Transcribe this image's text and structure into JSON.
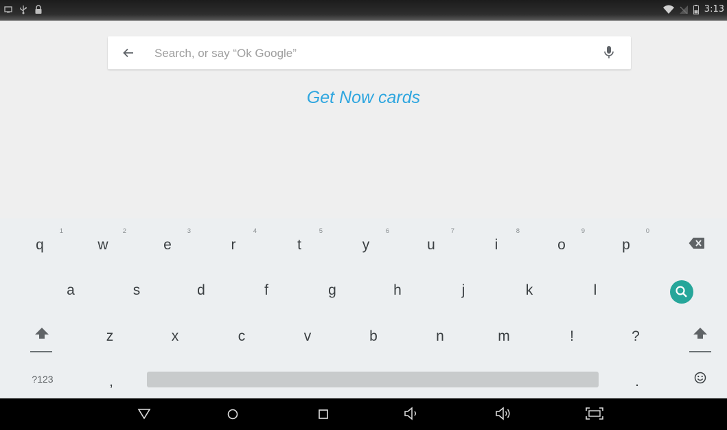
{
  "status_bar": {
    "time": "3:13",
    "left_icons": [
      "screenshot-icon",
      "usb-icon",
      "lock-icon"
    ],
    "right_icons": [
      "wifi-icon",
      "no-signal-icon",
      "battery-icon"
    ]
  },
  "search": {
    "placeholder": "Search, or say “Ok Google”",
    "value": ""
  },
  "get_now_cards": "Get Now cards",
  "keyboard": {
    "row1": [
      {
        "label": "q",
        "hint": "1"
      },
      {
        "label": "w",
        "hint": "2"
      },
      {
        "label": "e",
        "hint": "3"
      },
      {
        "label": "r",
        "hint": "4"
      },
      {
        "label": "t",
        "hint": "5"
      },
      {
        "label": "y",
        "hint": "6"
      },
      {
        "label": "u",
        "hint": "7"
      },
      {
        "label": "i",
        "hint": "8"
      },
      {
        "label": "o",
        "hint": "9"
      },
      {
        "label": "p",
        "hint": "0"
      }
    ],
    "row2": [
      "a",
      "s",
      "d",
      "f",
      "g",
      "h",
      "j",
      "k",
      "l"
    ],
    "row3": [
      "z",
      "x",
      "c",
      "v",
      "b",
      "n",
      "m",
      "!",
      "?"
    ],
    "symbols_key": "?123",
    "comma_key": ",",
    "period_key": ".",
    "accent_color": "#26a69a"
  },
  "nav": [
    "back-icon",
    "home-icon",
    "recents-icon",
    "volume-down-icon",
    "volume-up-icon",
    "screen-capture-icon"
  ]
}
